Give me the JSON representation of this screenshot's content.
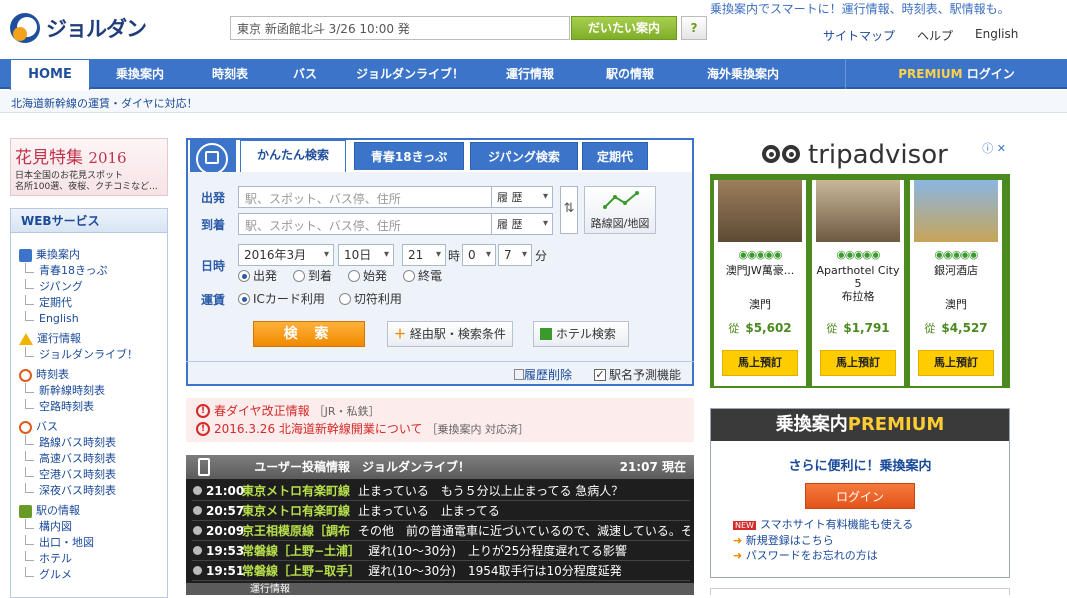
{
  "header": {
    "logo_text": "ジョルダン",
    "search_value": "東京 新函館北斗 3/26 10:00 発",
    "search_button": "だいたい案内",
    "help_button": "?",
    "tagline": "乗換案内でスマートに！運行情報、時刻表、駅情報も。",
    "links": [
      "サイトマップ",
      "ヘルプ",
      "English"
    ]
  },
  "nav": {
    "items": [
      "HOME",
      "乗換案内",
      "時刻表",
      "バス",
      "ジョルダンライブ！",
      "運行情報",
      "駅の情報",
      "海外乗換案内"
    ],
    "premium_word": "PREMIUM",
    "login": "ログイン"
  },
  "notice": "北海道新幹線の運賃・ダイヤに対応！",
  "banner": {
    "title": "花見特集",
    "year": "2016",
    "line1": "日本全国のお花見スポット",
    "line2": "名所100選、夜桜、クチコミなど..."
  },
  "websvc": {
    "title": "WEBサービス",
    "sections": [
      {
        "label": "乗換案内",
        "items": [
          "青春18きっぷ",
          "ジパング",
          "定期代",
          "English"
        ]
      },
      {
        "label": "運行情報",
        "items": [
          "ジョルダンライブ！"
        ]
      },
      {
        "label": "時刻表",
        "items": [
          "新幹線時刻表",
          "空路時刻表"
        ]
      },
      {
        "label": "バス",
        "items": [
          "路線バス時刻表",
          "高速バス時刻表",
          "空港バス時刻表",
          "深夜バス時刻表"
        ]
      },
      {
        "label": "駅の情報",
        "items": [
          "構内図",
          "出口・地図",
          "ホテル",
          "グルメ"
        ]
      }
    ]
  },
  "search": {
    "tabs": [
      "かんたん検索",
      "青春18きっぷ",
      "ジパング検索",
      "定期代"
    ],
    "from_label": "出発",
    "to_label": "到着",
    "placeholder": "駅、スポット、バス停、住所",
    "history": "履 歴",
    "map_button": "路線図/地図",
    "datetime_label": "日時",
    "month": "2016年3月",
    "day": "10日",
    "hour": "21",
    "hour_unit": "時",
    "min1": "0",
    "min2": "7",
    "min_unit": "分",
    "time_opts": [
      "出発",
      "到着",
      "始発",
      "終電"
    ],
    "fare_label": "運賃",
    "fare_opts": [
      "ICカード利用",
      "切符利用"
    ],
    "search_button": "検 索",
    "via_button": "経由駅・検索条件",
    "hotel_button": "ホテル検索",
    "clear_history": "履歴削除",
    "predict": "駅名予測機能"
  },
  "alerts": [
    {
      "link": "春ダイヤ改正情報",
      "tag": "［JR・私鉄］"
    },
    {
      "link": "2016.3.26 北海道新幹線開業について",
      "tag": "［乗換案内 対応済］"
    }
  ],
  "live": {
    "title": "ユーザー投稿情報　ジョルダンライブ！",
    "time": "21:07 現在",
    "rows": [
      {
        "time": "21:00",
        "line": "東京メトロ有楽町線",
        "text": "止まっている　もう５分以上止まってる 急病人？"
      },
      {
        "time": "20:57",
        "line": "東京メトロ有楽町線",
        "text": "止まっている　止まってる"
      },
      {
        "time": "20:09",
        "line": "京王相模原線［調布",
        "text": "その他　前の普通電車に近づいているので、減速している。それ"
      },
      {
        "time": "19:53",
        "line": "常磐線［上野−土浦］",
        "text": "遅れ(10〜30分)　上りが25分程度遅れてる影響"
      },
      {
        "time": "19:51",
        "line": "常磐線［上野−取手］",
        "text": "遅れ(10〜30分)　1954取手行は10分程度延発"
      }
    ],
    "next_header": "運行情報"
  },
  "ad": {
    "brand": "tripadvisor",
    "cards": [
      {
        "name": "澳門JW萬豪...",
        "place": "澳門",
        "from": "從",
        "price": "$5,602",
        "button": "馬上預訂"
      },
      {
        "name": "Aparthotel City 5",
        "name2": "布拉格",
        "place": "",
        "from": "從",
        "price": "$1,791",
        "button": "馬上預訂"
      },
      {
        "name": "銀河酒店",
        "place": "澳門",
        "from": "從",
        "price": "$4,527",
        "button": "馬上預訂"
      }
    ]
  },
  "premium": {
    "title_a": "乗換案内",
    "title_b": "PREMIUM",
    "lead": "さらに便利に！乗換案内",
    "login": "ログイン",
    "new_badge": "NEW",
    "links": [
      "スマホサイト有料機能も使える",
      "新規登録はこちら",
      "パスワードをお忘れの方は"
    ]
  }
}
